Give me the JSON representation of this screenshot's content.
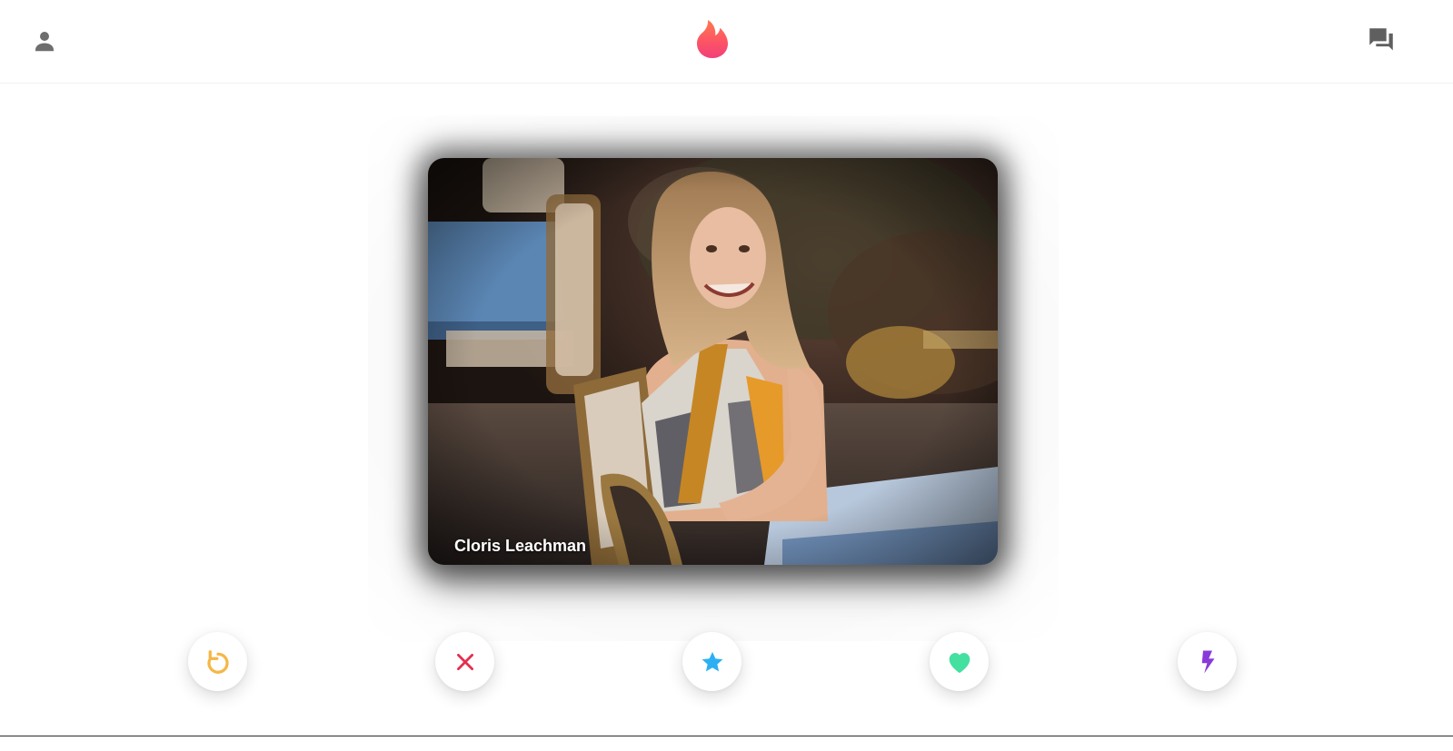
{
  "header": {
    "profile_icon": "person-icon",
    "logo_icon": "flame-logo",
    "chat_icon": "chat-bubbles-icon",
    "logo_color_top": "#fd5564",
    "logo_color_bottom": "#ef4a75"
  },
  "card": {
    "name": "Cloris Leachman",
    "photo": "portrait-photo"
  },
  "actions": [
    {
      "name": "rewind",
      "icon": "rewind-icon",
      "color": "#f5b748"
    },
    {
      "name": "nope",
      "icon": "close-icon",
      "color": "#e3304f"
    },
    {
      "name": "super-like",
      "icon": "star-icon",
      "color": "#2db0f3"
    },
    {
      "name": "like",
      "icon": "heart-icon",
      "color": "#43e0a0"
    },
    {
      "name": "boost",
      "icon": "lightning-icon",
      "color": "#8a3ad8"
    }
  ]
}
